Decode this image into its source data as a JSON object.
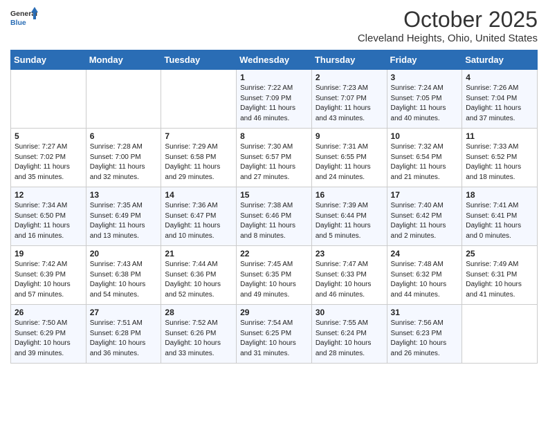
{
  "header": {
    "logo_general": "General",
    "logo_blue": "Blue",
    "month_title": "October 2025",
    "location": "Cleveland Heights, Ohio, United States"
  },
  "days_of_week": [
    "Sunday",
    "Monday",
    "Tuesday",
    "Wednesday",
    "Thursday",
    "Friday",
    "Saturday"
  ],
  "weeks": [
    [
      null,
      null,
      null,
      {
        "day": "1",
        "sunrise": "7:22 AM",
        "sunset": "7:09 PM",
        "daylight": "11 hours and 46 minutes."
      },
      {
        "day": "2",
        "sunrise": "7:23 AM",
        "sunset": "7:07 PM",
        "daylight": "11 hours and 43 minutes."
      },
      {
        "day": "3",
        "sunrise": "7:24 AM",
        "sunset": "7:05 PM",
        "daylight": "11 hours and 40 minutes."
      },
      {
        "day": "4",
        "sunrise": "7:26 AM",
        "sunset": "7:04 PM",
        "daylight": "11 hours and 37 minutes."
      }
    ],
    [
      {
        "day": "5",
        "sunrise": "7:27 AM",
        "sunset": "7:02 PM",
        "daylight": "11 hours and 35 minutes."
      },
      {
        "day": "6",
        "sunrise": "7:28 AM",
        "sunset": "7:00 PM",
        "daylight": "11 hours and 32 minutes."
      },
      {
        "day": "7",
        "sunrise": "7:29 AM",
        "sunset": "6:58 PM",
        "daylight": "11 hours and 29 minutes."
      },
      {
        "day": "8",
        "sunrise": "7:30 AM",
        "sunset": "6:57 PM",
        "daylight": "11 hours and 27 minutes."
      },
      {
        "day": "9",
        "sunrise": "7:31 AM",
        "sunset": "6:55 PM",
        "daylight": "11 hours and 24 minutes."
      },
      {
        "day": "10",
        "sunrise": "7:32 AM",
        "sunset": "6:54 PM",
        "daylight": "11 hours and 21 minutes."
      },
      {
        "day": "11",
        "sunrise": "7:33 AM",
        "sunset": "6:52 PM",
        "daylight": "11 hours and 18 minutes."
      }
    ],
    [
      {
        "day": "12",
        "sunrise": "7:34 AM",
        "sunset": "6:50 PM",
        "daylight": "11 hours and 16 minutes."
      },
      {
        "day": "13",
        "sunrise": "7:35 AM",
        "sunset": "6:49 PM",
        "daylight": "11 hours and 13 minutes."
      },
      {
        "day": "14",
        "sunrise": "7:36 AM",
        "sunset": "6:47 PM",
        "daylight": "11 hours and 10 minutes."
      },
      {
        "day": "15",
        "sunrise": "7:38 AM",
        "sunset": "6:46 PM",
        "daylight": "11 hours and 8 minutes."
      },
      {
        "day": "16",
        "sunrise": "7:39 AM",
        "sunset": "6:44 PM",
        "daylight": "11 hours and 5 minutes."
      },
      {
        "day": "17",
        "sunrise": "7:40 AM",
        "sunset": "6:42 PM",
        "daylight": "11 hours and 2 minutes."
      },
      {
        "day": "18",
        "sunrise": "7:41 AM",
        "sunset": "6:41 PM",
        "daylight": "11 hours and 0 minutes."
      }
    ],
    [
      {
        "day": "19",
        "sunrise": "7:42 AM",
        "sunset": "6:39 PM",
        "daylight": "10 hours and 57 minutes."
      },
      {
        "day": "20",
        "sunrise": "7:43 AM",
        "sunset": "6:38 PM",
        "daylight": "10 hours and 54 minutes."
      },
      {
        "day": "21",
        "sunrise": "7:44 AM",
        "sunset": "6:36 PM",
        "daylight": "10 hours and 52 minutes."
      },
      {
        "day": "22",
        "sunrise": "7:45 AM",
        "sunset": "6:35 PM",
        "daylight": "10 hours and 49 minutes."
      },
      {
        "day": "23",
        "sunrise": "7:47 AM",
        "sunset": "6:33 PM",
        "daylight": "10 hours and 46 minutes."
      },
      {
        "day": "24",
        "sunrise": "7:48 AM",
        "sunset": "6:32 PM",
        "daylight": "10 hours and 44 minutes."
      },
      {
        "day": "25",
        "sunrise": "7:49 AM",
        "sunset": "6:31 PM",
        "daylight": "10 hours and 41 minutes."
      }
    ],
    [
      {
        "day": "26",
        "sunrise": "7:50 AM",
        "sunset": "6:29 PM",
        "daylight": "10 hours and 39 minutes."
      },
      {
        "day": "27",
        "sunrise": "7:51 AM",
        "sunset": "6:28 PM",
        "daylight": "10 hours and 36 minutes."
      },
      {
        "day": "28",
        "sunrise": "7:52 AM",
        "sunset": "6:26 PM",
        "daylight": "10 hours and 33 minutes."
      },
      {
        "day": "29",
        "sunrise": "7:54 AM",
        "sunset": "6:25 PM",
        "daylight": "10 hours and 31 minutes."
      },
      {
        "day": "30",
        "sunrise": "7:55 AM",
        "sunset": "6:24 PM",
        "daylight": "10 hours and 28 minutes."
      },
      {
        "day": "31",
        "sunrise": "7:56 AM",
        "sunset": "6:23 PM",
        "daylight": "10 hours and 26 minutes."
      },
      null
    ]
  ]
}
